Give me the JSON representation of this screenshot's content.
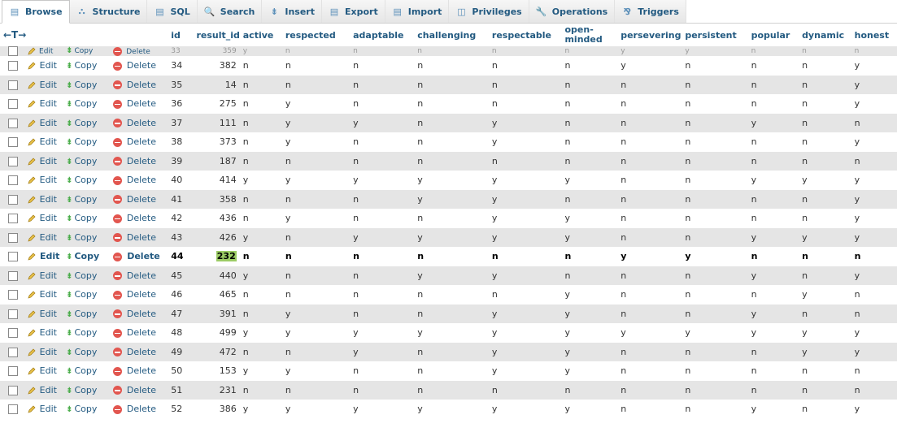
{
  "tabs": [
    {
      "label": "Browse",
      "icon": "browse-icon",
      "glyph": "▤",
      "active": true
    },
    {
      "label": "Structure",
      "icon": "structure-icon",
      "glyph": "⛬"
    },
    {
      "label": "SQL",
      "icon": "sql-icon",
      "glyph": "▤"
    },
    {
      "label": "Search",
      "icon": "search-icon",
      "glyph": "🔍"
    },
    {
      "label": "Insert",
      "icon": "insert-icon",
      "glyph": "⇟"
    },
    {
      "label": "Export",
      "icon": "export-icon",
      "glyph": "▤"
    },
    {
      "label": "Import",
      "icon": "import-icon",
      "glyph": "▤"
    },
    {
      "label": "Privileges",
      "icon": "privileges-icon",
      "glyph": "◫"
    },
    {
      "label": "Operations",
      "icon": "operations-icon",
      "glyph": "🔧"
    },
    {
      "label": "Triggers",
      "icon": "triggers-icon",
      "glyph": "⅋"
    }
  ],
  "table": {
    "arrows": "←T→",
    "columns": [
      "id",
      "result_id",
      "active",
      "respected",
      "adaptable",
      "challenging",
      "respectable",
      "open-minded",
      "persevering",
      "persistent",
      "popular",
      "dynamic",
      "honest"
    ],
    "actions": {
      "edit": "Edit",
      "copy": "Copy",
      "delete": "Delete"
    },
    "partial_row": [
      "33",
      "359",
      "y",
      "n",
      "n",
      "n",
      "n",
      "n",
      "y",
      "y",
      "n",
      "n",
      "n"
    ],
    "rows": [
      [
        "34",
        "382",
        "n",
        "n",
        "n",
        "n",
        "n",
        "n",
        "y",
        "n",
        "n",
        "n",
        "y"
      ],
      [
        "35",
        "14",
        "n",
        "n",
        "n",
        "n",
        "n",
        "n",
        "n",
        "n",
        "n",
        "n",
        "y"
      ],
      [
        "36",
        "275",
        "n",
        "y",
        "n",
        "n",
        "n",
        "n",
        "n",
        "n",
        "n",
        "n",
        "y"
      ],
      [
        "37",
        "111",
        "n",
        "y",
        "y",
        "n",
        "y",
        "n",
        "n",
        "n",
        "y",
        "n",
        "n"
      ],
      [
        "38",
        "373",
        "n",
        "y",
        "n",
        "n",
        "y",
        "n",
        "n",
        "n",
        "n",
        "n",
        "y"
      ],
      [
        "39",
        "187",
        "n",
        "n",
        "n",
        "n",
        "n",
        "n",
        "n",
        "n",
        "n",
        "n",
        "n"
      ],
      [
        "40",
        "414",
        "y",
        "y",
        "y",
        "y",
        "y",
        "y",
        "n",
        "n",
        "y",
        "y",
        "y"
      ],
      [
        "41",
        "358",
        "n",
        "n",
        "n",
        "y",
        "y",
        "n",
        "n",
        "n",
        "n",
        "n",
        "y"
      ],
      [
        "42",
        "436",
        "n",
        "y",
        "n",
        "n",
        "y",
        "y",
        "n",
        "n",
        "n",
        "n",
        "y"
      ],
      [
        "43",
        "426",
        "y",
        "n",
        "y",
        "y",
        "y",
        "y",
        "n",
        "n",
        "y",
        "y",
        "y"
      ],
      [
        "44",
        "232",
        "n",
        "n",
        "n",
        "n",
        "n",
        "n",
        "y",
        "y",
        "n",
        "n",
        "n"
      ],
      [
        "45",
        "440",
        "y",
        "n",
        "n",
        "y",
        "y",
        "n",
        "n",
        "n",
        "y",
        "n",
        "y"
      ],
      [
        "46",
        "465",
        "n",
        "n",
        "n",
        "n",
        "n",
        "y",
        "n",
        "n",
        "n",
        "y",
        "n"
      ],
      [
        "47",
        "391",
        "n",
        "y",
        "n",
        "n",
        "y",
        "y",
        "n",
        "n",
        "y",
        "n",
        "n"
      ],
      [
        "48",
        "499",
        "y",
        "y",
        "y",
        "y",
        "y",
        "y",
        "y",
        "y",
        "y",
        "y",
        "y"
      ],
      [
        "49",
        "472",
        "n",
        "n",
        "y",
        "n",
        "y",
        "y",
        "n",
        "n",
        "n",
        "y",
        "y"
      ],
      [
        "50",
        "153",
        "y",
        "y",
        "n",
        "n",
        "y",
        "y",
        "n",
        "n",
        "n",
        "n",
        "n"
      ],
      [
        "51",
        "231",
        "n",
        "n",
        "n",
        "n",
        "n",
        "n",
        "n",
        "n",
        "n",
        "n",
        "n"
      ],
      [
        "52",
        "386",
        "y",
        "y",
        "y",
        "y",
        "y",
        "y",
        "n",
        "n",
        "y",
        "n",
        "y"
      ]
    ]
  }
}
